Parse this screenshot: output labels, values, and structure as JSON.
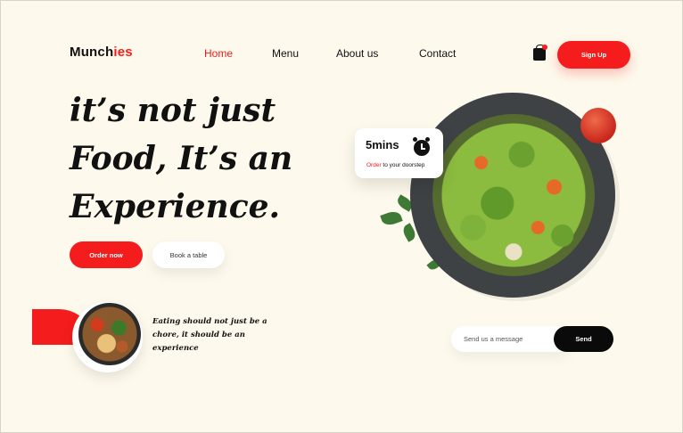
{
  "brand": {
    "name_part1": "Munch",
    "name_part2": "ies"
  },
  "nav": {
    "home": "Home",
    "menu": "Menu",
    "about": "About us",
    "contact": "Contact"
  },
  "header": {
    "signup_label": "Sign Up"
  },
  "hero": {
    "line1": "it’s not just",
    "line2": "Food, It’s an",
    "line3": "Experience.",
    "order_label": "Order now",
    "book_label": "Book a table"
  },
  "delivery_card": {
    "time": "5mins",
    "order_word": "Order",
    "rest": " to your doorstep"
  },
  "tagline": "Eating should not just be a chore, it should be an experience",
  "message": {
    "placeholder": "Send us a message",
    "send_label": "Send"
  },
  "colors": {
    "accent": "#f41c1c",
    "background": "#fdf9ec",
    "dark": "#0a0a0a"
  },
  "icons": {
    "cart": "cart-icon",
    "clock": "alarm-clock-icon"
  }
}
